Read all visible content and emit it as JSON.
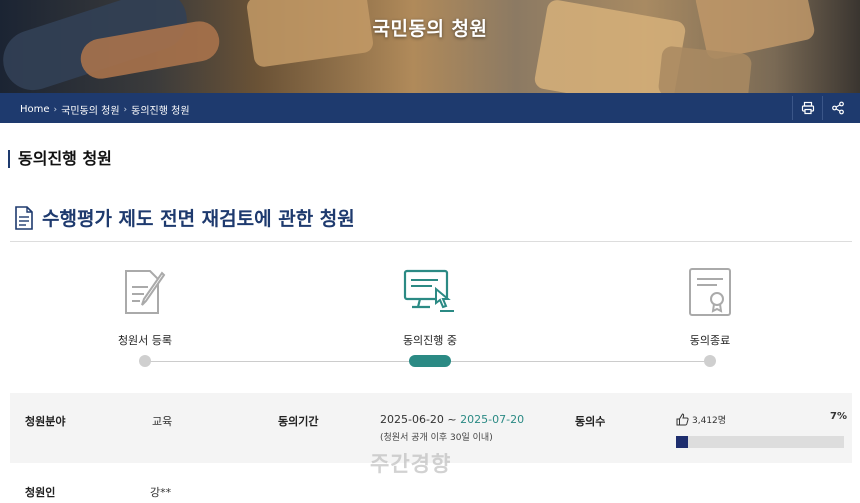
{
  "hero": {
    "title": "국민동의 청원"
  },
  "breadcrumb": {
    "items": [
      "Home",
      "국민동의 청원",
      "동의진행 청원"
    ]
  },
  "tools": {
    "print_icon": "print-icon",
    "share_icon": "share-icon"
  },
  "section": {
    "title": "동의진행 청원"
  },
  "petition": {
    "title": "수행평가 제도 전면 재검토에 관한 청원",
    "icon": "document-icon"
  },
  "steps": [
    {
      "label": "청원서 등록",
      "icon": "register-pen-icon",
      "active": false
    },
    {
      "label": "동의진행 중",
      "icon": "computer-click-icon",
      "active": true
    },
    {
      "label": "동의종료",
      "icon": "certificate-icon",
      "active": false
    }
  ],
  "info": {
    "field_label": "청원분야",
    "field_value": "교육",
    "period_label": "동의기간",
    "period_start": "2025-06-20",
    "period_sep": " ~ ",
    "period_end": "2025-07-20",
    "period_note": "(청원서 공개 이후 30일 이내)",
    "count_label": "동의수",
    "count_value": "3,412명",
    "count_percent": "7%",
    "progress": 0.07,
    "petitioner_label": "청원인",
    "petitioner_value": "강**"
  },
  "watermark": "주간경향",
  "colors": {
    "navy": "#1e3a6e",
    "teal": "#2b8a84",
    "progress_fill": "#1e2e6e"
  }
}
